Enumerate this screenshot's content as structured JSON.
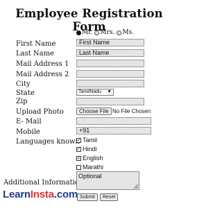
{
  "title": "Employee Registration Form",
  "salutation": {
    "options": [
      "Mr.",
      "Mrs.",
      "Ms."
    ],
    "selected": "Mr."
  },
  "fields": {
    "first_name": {
      "label": "First Name",
      "value": "First Name"
    },
    "last_name": {
      "label": "Last Name",
      "value": "Last Name"
    },
    "address1": {
      "label": "Mail Address 1",
      "value": ""
    },
    "address2": {
      "label": "Mail Address 2",
      "value": ""
    },
    "city": {
      "label": "City",
      "value": ""
    },
    "state": {
      "label": "State",
      "value": "TamilNadu"
    },
    "zip": {
      "label": "Zip",
      "value": ""
    },
    "photo": {
      "label": "Upload Photo",
      "button": "Choose File",
      "status": "No File Chosen"
    },
    "email": {
      "label": "E- Mail",
      "value": ""
    },
    "mobile": {
      "label": "Mobile",
      "value": "+91"
    },
    "languages": {
      "label": "Languages known",
      "items": [
        {
          "name": "Tamil",
          "checked": true
        },
        {
          "name": "Hindi",
          "checked": true
        },
        {
          "name": "English",
          "checked": true
        },
        {
          "name": "Marathi",
          "checked": false
        }
      ]
    },
    "additional": {
      "label": "Additional Information",
      "value": "Optional"
    }
  },
  "buttons": {
    "submit": "Submit",
    "reset": "Reset"
  },
  "brand": {
    "part1": "Learn",
    "part2": "Insta",
    "part3": ".com"
  },
  "icons": {
    "select_arrow": "▼",
    "check": "✓"
  }
}
